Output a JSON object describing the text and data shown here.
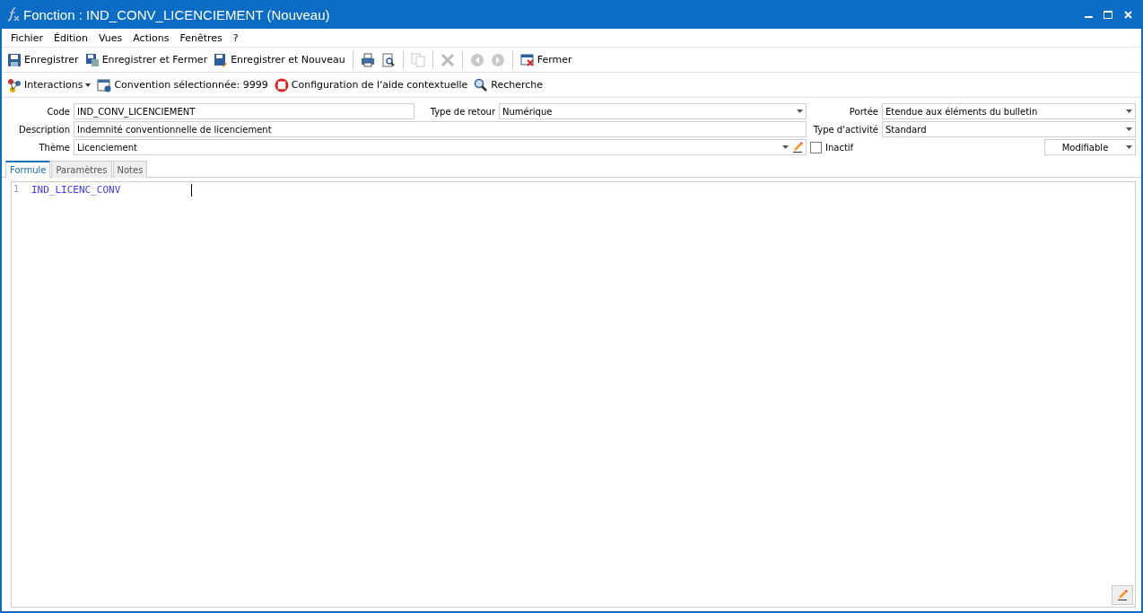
{
  "window": {
    "title": "Fonction : IND_CONV_LICENCIEMENT (Nouveau)"
  },
  "menu": [
    "Fichier",
    "Édition",
    "Vues",
    "Actions",
    "Fenêtres",
    "?"
  ],
  "toolbar": [
    {
      "kind": "button",
      "label": "Enregistrer",
      "disabled": false
    },
    {
      "kind": "button",
      "label": "Enregistrer et Fermer",
      "disabled": false
    },
    {
      "kind": "button",
      "label": "Enregistrer et Nouveau",
      "disabled": false
    },
    {
      "kind": "separator"
    },
    {
      "kind": "button",
      "disabled": false
    },
    {
      "kind": "button",
      "disabled": false
    },
    {
      "kind": "separator"
    },
    {
      "kind": "button",
      "disabled": true
    },
    {
      "kind": "separator"
    },
    {
      "kind": "button",
      "disabled": true
    },
    {
      "kind": "separator"
    },
    {
      "kind": "button",
      "disabled": true
    },
    {
      "kind": "button",
      "disabled": true
    },
    {
      "kind": "separator"
    },
    {
      "kind": "button",
      "label": "Fermer",
      "disabled": false
    }
  ],
  "toolbar2": [
    {
      "kind": "dropdown",
      "label": "Interactions"
    },
    {
      "kind": "button",
      "label": "Convention sélectionnée: 9999"
    },
    {
      "kind": "button",
      "label": "Configuration de l'aide contextuelle"
    },
    {
      "kind": "button",
      "label": "Recherche"
    }
  ],
  "form": {
    "code": {
      "label": "Code",
      "value": "IND_CONV_LICENCIEMENT"
    },
    "type_retour": {
      "label": "Type de retour",
      "value": "Numérique"
    },
    "description": {
      "label": "Description",
      "value": "Indemnité conventionnelle de licenciement"
    },
    "theme": {
      "label": "Thème",
      "value": "Licenciement"
    },
    "portee": {
      "label": "Portée",
      "value": "Etendue aux éléments du bulletin"
    },
    "type_activite": {
      "label": "Type d'activité",
      "value": "Standard"
    },
    "inactif": {
      "label": "Inactif",
      "checked": false
    },
    "mode": {
      "value": "Modifiable"
    }
  },
  "tabs": [
    {
      "label": "Formule",
      "selected": true
    },
    {
      "label": "Paramètres",
      "selected": false
    },
    {
      "label": "Notes",
      "selected": false
    }
  ],
  "editor": {
    "lines": [
      {
        "number": "1",
        "code": "IND_LICENC_CONV"
      }
    ]
  }
}
